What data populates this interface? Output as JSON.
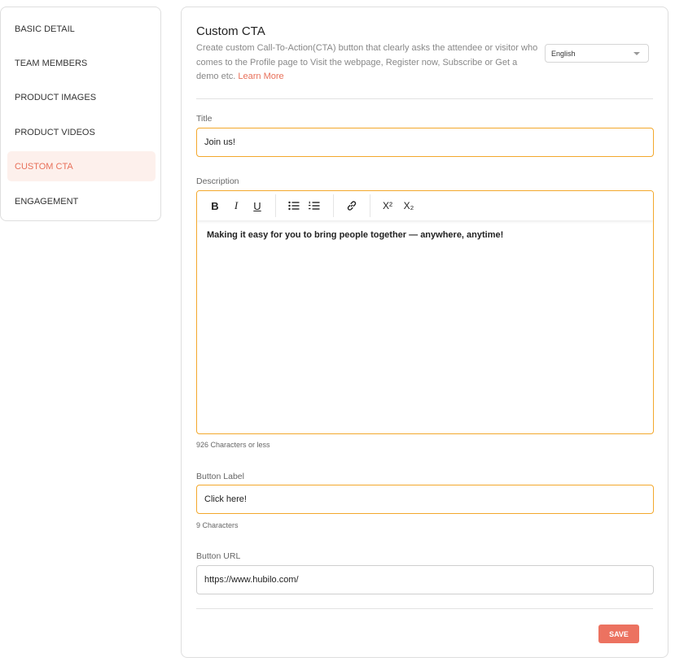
{
  "sidebar": {
    "items": [
      {
        "label": "BASIC DETAIL"
      },
      {
        "label": "TEAM MEMBERS"
      },
      {
        "label": "PRODUCT IMAGES"
      },
      {
        "label": "PRODUCT VIDEOS"
      },
      {
        "label": "CUSTOM CTA",
        "active": true
      },
      {
        "label": "ENGAGEMENT"
      }
    ]
  },
  "header": {
    "title": "Custom CTA",
    "description": "Create custom Call-To-Action(CTA) button that clearly asks the attendee or visitor who comes to the Profile page to Visit the webpage, Register now, Subscribe or Get a demo etc.",
    "learn_more": "Learn More",
    "language": "English"
  },
  "form": {
    "title_label": "Title",
    "title_value": "Join us!",
    "description_label": "Description",
    "description_value": "Making it easy for you to bring people together — anywhere, anytime!",
    "description_hint": "926 Characters or less",
    "button_label_label": "Button Label",
    "button_label_value": "Click here!",
    "button_label_hint": "9 Characters",
    "button_url_label": "Button URL",
    "button_url_value": "https://www.hubilo.com/"
  },
  "toolbar": {
    "bold": "B",
    "italic": "I",
    "underline": "U",
    "superscript": "X²",
    "subscript": "X₂"
  },
  "actions": {
    "save_label": "SAVE"
  },
  "colors": {
    "accent": "#ec7260",
    "focus_border": "#f3a82c",
    "active_bg": "#fdf0ec"
  }
}
